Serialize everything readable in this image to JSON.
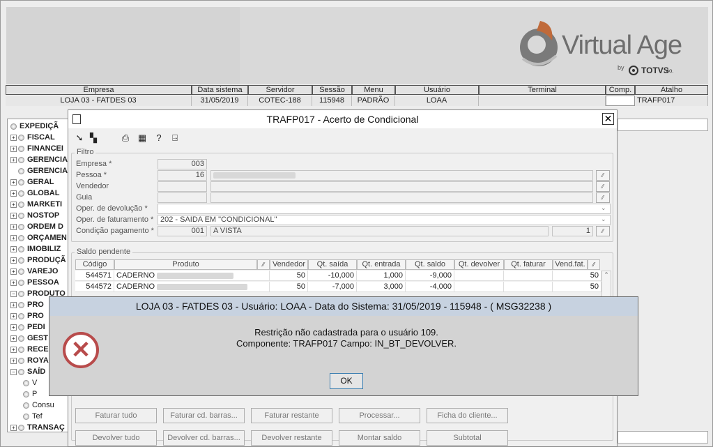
{
  "header": {
    "columns": [
      {
        "label": "Empresa",
        "value": "LOJA 03 - FATDES 03"
      },
      {
        "label": "Data sistema",
        "value": "31/05/2019"
      },
      {
        "label": "Servidor",
        "value": "COTEC-188"
      },
      {
        "label": "Sessão",
        "value": "115948"
      },
      {
        "label": "Menu",
        "value": "PADRÃO"
      },
      {
        "label": "Usuário",
        "value": "LOAA"
      },
      {
        "label": "Terminal",
        "value": ""
      },
      {
        "label": "Comp.",
        "value": ""
      },
      {
        "label": "Atalho",
        "value": "TRAFP017"
      }
    ]
  },
  "logo": {
    "name": "Virtual Age",
    "by": "by",
    "totvs": "TOTVS",
    "co": "co."
  },
  "tree": {
    "items": [
      {
        "label": "EXPEDIÇÃ"
      },
      {
        "label": "FISCAL"
      },
      {
        "label": "FINANCEI"
      },
      {
        "label": "GERENCIA"
      },
      {
        "label": "GERENCIA"
      },
      {
        "label": "GERAL"
      },
      {
        "label": "GLOBAL"
      },
      {
        "label": "MARKETI"
      },
      {
        "label": "NOSTOP"
      },
      {
        "label": "ORDEM D"
      },
      {
        "label": "ORÇAMEN"
      },
      {
        "label": "IMOBILIZ"
      },
      {
        "label": "PRODUÇÃ"
      },
      {
        "label": "VAREJO"
      },
      {
        "label": "PESSOA"
      },
      {
        "label": "PRODUTO"
      },
      {
        "label": "PRO"
      },
      {
        "label": "PRO"
      },
      {
        "label": "PEDI"
      },
      {
        "label": "GEST"
      },
      {
        "label": "RECE"
      },
      {
        "label": "ROYA"
      },
      {
        "label": "SAÍD"
      },
      {
        "label": "V"
      },
      {
        "label": "P"
      },
      {
        "label": "Consu"
      },
      {
        "label": "Tef"
      },
      {
        "label": "TRANSAÇ"
      }
    ]
  },
  "dialog": {
    "title": "TRAFP017 - Acerto de Condicional",
    "close": "✕",
    "filtro": {
      "title": "Filtro",
      "empresa_label": "Empresa *",
      "empresa_value": "003",
      "pessoa_label": "Pessoa *",
      "pessoa_value": "16",
      "vendedor_label": "Vendedor",
      "guia_label": "Guia",
      "oper_dev_label": "Oper. de devolução *",
      "oper_dev_value": "",
      "oper_fat_label": "Oper. de faturamento *",
      "oper_fat_value": "202 - SAIDA EM \"CONDICIONAL\"",
      "cond_label": "Condição pagamento *",
      "cond_code": "001",
      "cond_value": "A VISTA",
      "cond_num": "1"
    },
    "saldo": {
      "title": "Saldo pendente",
      "columns": [
        "Código",
        "Produto",
        "Vendedor",
        "Qt. saída",
        "Qt. entrada",
        "Qt. saldo",
        "Qt. devolver",
        "Qt. faturar",
        "Vend.fat."
      ],
      "rows": [
        {
          "codigo": "544571",
          "produto": "CADERNO",
          "vendedor": "50",
          "saida": "-10,000",
          "entrada": "1,000",
          "saldo": "-9,000",
          "devolver": "",
          "faturar": "",
          "vendfat": "50"
        },
        {
          "codigo": "544572",
          "produto": "CADERNO",
          "vendedor": "50",
          "saida": "-7,000",
          "entrada": "3,000",
          "saldo": "-4,000",
          "devolver": "",
          "faturar": "",
          "vendfat": "50"
        }
      ]
    },
    "buttons_row1": [
      "Faturar tudo",
      "Faturar cd. barras...",
      "Faturar restante",
      "Processar...",
      "Ficha do cliente..."
    ],
    "buttons_row2": [
      "Devolver tudo",
      "Devolver cd. barras...",
      "Devolver restante",
      "Montar saldo",
      "Subtotal"
    ]
  },
  "message": {
    "title": "LOJA 03 - FATDES 03 - Usuário: LOAA - Data do Sistema: 31/05/2019 - 115948 - ( MSG32238 )",
    "line1": "Restrição não cadastrada para o usuário 109.",
    "line2": "Componente: TRAFP017 Campo: IN_BT_DEVOLVER.",
    "ok": "OK",
    "icon": "error-icon",
    "icon_color": "#b84b4b"
  }
}
